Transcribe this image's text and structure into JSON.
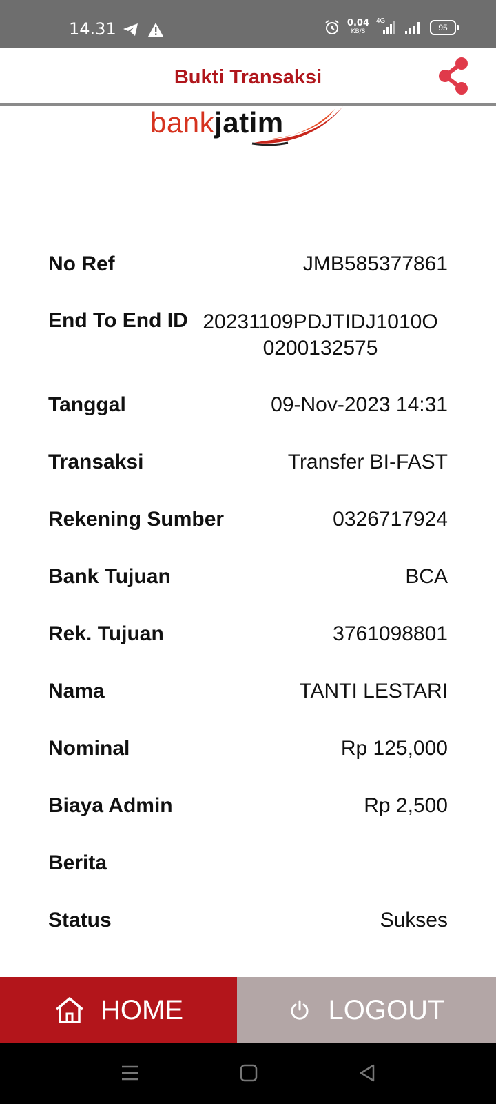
{
  "status_bar": {
    "time": "14.31",
    "speed_value": "0.04",
    "speed_unit": "KB/S",
    "network": "4G",
    "battery": "95",
    "icons": [
      "telegram-icon",
      "warning-icon",
      "alarm-icon",
      "signal-icon",
      "signal-icon",
      "battery-icon"
    ]
  },
  "header": {
    "title": "Bukti Transaksi",
    "share_icon": "share-icon",
    "accent_color": "#b0161c"
  },
  "logo": {
    "bank": "bank",
    "jatim": "jatim"
  },
  "details": [
    {
      "label": "No Ref",
      "value": "JMB585377861"
    },
    {
      "label": "End To End ID",
      "value": "20231109PDJTIDJ1010O 0200132575"
    },
    {
      "label": "Tanggal",
      "value": "09-Nov-2023 14:31"
    },
    {
      "label": "Transaksi",
      "value": "Transfer BI-FAST"
    },
    {
      "label": "Rekening Sumber",
      "value": "0326717924"
    },
    {
      "label": "Bank Tujuan",
      "value": "BCA"
    },
    {
      "label": "Rek. Tujuan",
      "value": "3761098801"
    },
    {
      "label": "Nama",
      "value": "TANTI LESTARI"
    },
    {
      "label": "Nominal",
      "value": "Rp 125,000"
    },
    {
      "label": "Biaya Admin",
      "value": "Rp 2,500"
    },
    {
      "label": "Berita",
      "value": ""
    },
    {
      "label": "Status",
      "value": "Sukses"
    }
  ],
  "buttons": {
    "home": "HOME",
    "logout": "LOGOUT",
    "home_color": "#b3151b",
    "logout_color": "#b3a6a6"
  },
  "nav_icons": [
    "menu-icon",
    "home-square-icon",
    "back-icon"
  ]
}
